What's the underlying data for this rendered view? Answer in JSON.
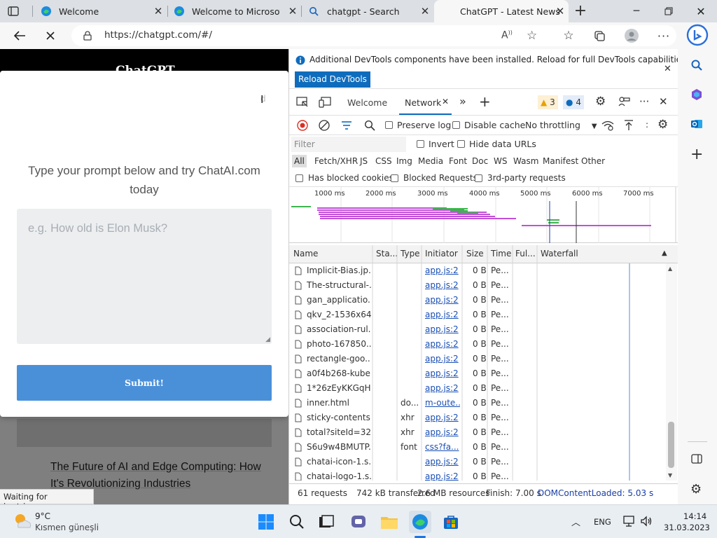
{
  "browser": {
    "tabs": [
      {
        "title": "Welcome"
      },
      {
        "title": "Welcome to Microsoft Edge"
      },
      {
        "title": "chatgpt - Search"
      },
      {
        "title": "ChatGPT - Latest News"
      }
    ],
    "address_url": "https://chatgpt.com/#/",
    "status_text": "Waiting for js.stripe.c..."
  },
  "page": {
    "header_title": "ChatGPT",
    "modal": {
      "prompt_heading": "Type your prompt below and try ChatAI.com today",
      "textarea_placeholder": "e.g. How old is Elon Musk?",
      "submit_label": "Submit!"
    },
    "article_link": "The Future of AI and Edge Computing: How It's Revolutionizing Industries"
  },
  "devtools": {
    "info_message": "Additional DevTools components have been installed. Reload for full DevTools capabilities.",
    "reload_button": "Reload DevTools",
    "tabs": {
      "welcome": "Welcome",
      "network": "Network"
    },
    "badges": {
      "warnings": "3",
      "issues": "4"
    },
    "toolbar": {
      "preserve_log": "Preserve log",
      "disable_cache": "Disable cache",
      "throttling": "No throttling"
    },
    "filter_placeholder": "Filter",
    "invert_label": "Invert",
    "hide_data_urls": "Hide data URLs",
    "type_filters": [
      "All",
      "Fetch/XHR",
      "JS",
      "CSS",
      "Img",
      "Media",
      "Font",
      "Doc",
      "WS",
      "Wasm",
      "Manifest",
      "Other"
    ],
    "blocked_cookies": "Has blocked cookies",
    "blocked_requests": "Blocked Requests",
    "third_party": "3rd-party requests",
    "overview_ticks": [
      "1000 ms",
      "2000 ms",
      "3000 ms",
      "4000 ms",
      "5000 ms",
      "6000 ms",
      "7000 ms"
    ],
    "columns": [
      "Name",
      "Sta...",
      "Type",
      "Initiator",
      "Size",
      "Time",
      "Ful...",
      "Waterfall"
    ],
    "rows": [
      {
        "name": "Implicit-Bias.jp...",
        "status": "",
        "type": "",
        "initiator": "app.js:2",
        "size": "0 B",
        "time": "Pe..."
      },
      {
        "name": "The-structural-...",
        "status": "",
        "type": "",
        "initiator": "app.js:2",
        "size": "0 B",
        "time": "Pe..."
      },
      {
        "name": "gan_applicatio...",
        "status": "",
        "type": "",
        "initiator": "app.js:2",
        "size": "0 B",
        "time": "Pe..."
      },
      {
        "name": "qkv_2-1536x64...",
        "status": "",
        "type": "",
        "initiator": "app.js:2",
        "size": "0 B",
        "time": "Pe..."
      },
      {
        "name": "association-rul...",
        "status": "",
        "type": "",
        "initiator": "app.js:2",
        "size": "0 B",
        "time": "Pe..."
      },
      {
        "name": "photo-167850...",
        "status": "",
        "type": "",
        "initiator": "app.js:2",
        "size": "0 B",
        "time": "Pe..."
      },
      {
        "name": "rectangle-goo...",
        "status": "",
        "type": "",
        "initiator": "app.js:2",
        "size": "0 B",
        "time": "Pe..."
      },
      {
        "name": "a0f4b268-kube...",
        "status": "",
        "type": "",
        "initiator": "app.js:2",
        "size": "0 B",
        "time": "Pe..."
      },
      {
        "name": "1*26zEyKKGqH...",
        "status": "",
        "type": "",
        "initiator": "app.js:2",
        "size": "0 B",
        "time": "Pe..."
      },
      {
        "name": "inner.html",
        "status": "",
        "type": "do...",
        "initiator": "m-oute...",
        "size": "0 B",
        "time": "Pe..."
      },
      {
        "name": "sticky-contents...",
        "status": "",
        "type": "xhr",
        "initiator": "app.js:2",
        "size": "0 B",
        "time": "Pe..."
      },
      {
        "name": "total?siteId=32...",
        "status": "",
        "type": "xhr",
        "initiator": "app.js:2",
        "size": "0 B",
        "time": "Pe..."
      },
      {
        "name": "S6u9w4BMUTP...",
        "status": "",
        "type": "font",
        "initiator": "css?fa...",
        "size": "0 B",
        "time": "Pe..."
      },
      {
        "name": "chatai-icon-1.s...",
        "status": "",
        "type": "",
        "initiator": "app.js:2",
        "size": "0 B",
        "time": "Pe..."
      },
      {
        "name": "chatai-logo-1.s...",
        "status": "",
        "type": "",
        "initiator": "app.js:2",
        "size": "0 B",
        "time": "Pe..."
      }
    ],
    "summary": {
      "requests": "61 requests",
      "transferred": "742 kB transferred",
      "resources": "2.6 MB resources",
      "finish": "Finish: 7.00 s",
      "dom_content_loaded": "DOMContentLoaded: 5.03 s"
    }
  },
  "taskbar": {
    "weather_temp": "9°C",
    "weather_desc": "Kısmen güneşli",
    "language": "ENG",
    "time": "14:14",
    "date": "31.03.2023"
  },
  "colors": {
    "accent_blue": "#0f6cbd",
    "submit_button": "#4a90d9",
    "request_bar": "#c050d8",
    "download_bar": "#3fb54f"
  }
}
